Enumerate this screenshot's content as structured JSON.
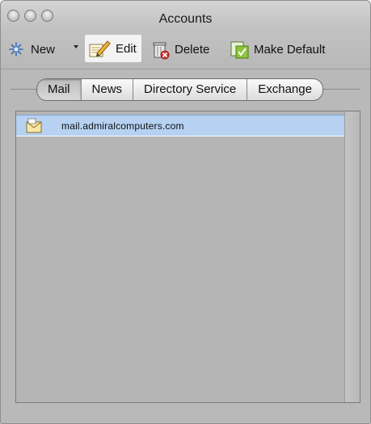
{
  "window": {
    "title": "Accounts"
  },
  "toolbar": {
    "new_label": "New",
    "edit_label": "Edit",
    "delete_label": "Delete",
    "make_default_label": "Make Default"
  },
  "tabs": [
    {
      "label": "Mail",
      "selected": true
    },
    {
      "label": "News",
      "selected": false
    },
    {
      "label": "Directory Service",
      "selected": false
    },
    {
      "label": "Exchange",
      "selected": false
    }
  ],
  "accounts": [
    {
      "name": "mail.admiralcomputers.com",
      "icon": "mail-account-icon",
      "selected": true
    }
  ],
  "colors": {
    "selection": "#b6d1f1",
    "window_bg": "#b9b9b9"
  }
}
